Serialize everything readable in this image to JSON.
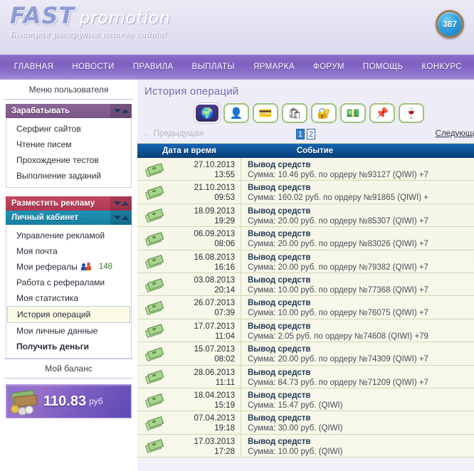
{
  "header": {
    "logo_main": "FAST",
    "logo_sub": "promotion",
    "slogan": "Быстрая раскрутка вашего сайта!",
    "counter": "387"
  },
  "nav": {
    "items": [
      {
        "label": "ГЛАВНАЯ"
      },
      {
        "label": "НОВОСТИ"
      },
      {
        "label": "ПРАВИЛА"
      },
      {
        "label": "ВЫПЛАТЫ"
      },
      {
        "label": "ЯРМАРКА"
      },
      {
        "label": "ФОРУМ"
      },
      {
        "label": "ПОМОЩЬ"
      },
      {
        "label": "КОНКУРС"
      }
    ]
  },
  "sidebar": {
    "title": "Меню пользователя",
    "earn_header": "Зарабатывать",
    "earn_items": [
      {
        "label": "Серфинг сайтов"
      },
      {
        "label": "Чтение писем"
      },
      {
        "label": "Прохождение тестов"
      },
      {
        "label": "Выполнение заданий"
      }
    ],
    "ads_header": "Разместить рекламу",
    "account_header": "Личный кабинет",
    "account_items": [
      {
        "label": "Управление рекламой"
      },
      {
        "label": "Моя почта"
      },
      {
        "label": "Мои рефералы",
        "count": "148"
      },
      {
        "label": "Работа с рефералами"
      },
      {
        "label": "Моя статистика"
      },
      {
        "label": "История операций"
      },
      {
        "label": "Мои личные данные"
      },
      {
        "label": "Получить деньги"
      }
    ],
    "balance_title": "Мой баланс",
    "balance_value": "110.83",
    "balance_currency": "руб"
  },
  "main": {
    "page_title": "История операций",
    "tabs": [
      {
        "name": "globe",
        "glyph": "🌍"
      },
      {
        "name": "person",
        "glyph": "👤"
      },
      {
        "name": "wallet",
        "glyph": "💳"
      },
      {
        "name": "shopping-bag",
        "glyph": "🛍"
      },
      {
        "name": "lock",
        "glyph": "🔐"
      },
      {
        "name": "money",
        "glyph": "💵"
      },
      {
        "name": "megaphone",
        "glyph": "📌"
      },
      {
        "name": "wine-glass",
        "glyph": "🍷"
      }
    ],
    "pager": {
      "prev": "← Предыдущая",
      "next": "Следующая",
      "pages": [
        {
          "label": "1",
          "selected": true
        },
        {
          "label": "2",
          "selected": false
        }
      ]
    },
    "table": {
      "columns": [
        "Дата и время",
        "Событие"
      ],
      "rows": [
        {
          "date": "27.10.2013",
          "time": "13:55",
          "title": "Вывод средств",
          "detail": "Сумма: 10.46 руб. по ордеру №93127 (QIWI) +7"
        },
        {
          "date": "21.10.2013",
          "time": "09:53",
          "title": "Вывод средств",
          "detail": "Сумма: 160.02 руб. по ордеру №91865 (QIWI) +"
        },
        {
          "date": "18.09.2013",
          "time": "19:29",
          "title": "Вывод средств",
          "detail": "Сумма: 20.00 руб. по ордеру №85307 (QIWI) +7"
        },
        {
          "date": "06.09.2013",
          "time": "08:06",
          "title": "Вывод средств",
          "detail": "Сумма: 20.00 руб. по ордеру №83026 (QIWI) +7"
        },
        {
          "date": "16.08.2013",
          "time": "16:16",
          "title": "Вывод средств",
          "detail": "Сумма: 20.00 руб. по ордеру №79382 (QIWI) +7"
        },
        {
          "date": "03.08.2013",
          "time": "20:14",
          "title": "Вывод средств",
          "detail": "Сумма: 10.00 руб. по ордеру №77368 (QIWI) +7"
        },
        {
          "date": "26.07.2013",
          "time": "07:39",
          "title": "Вывод средств",
          "detail": "Сумма: 10.00 руб. по ордеру №76075 (QIWI) +7"
        },
        {
          "date": "17.07.2013",
          "time": "11:04",
          "title": "Вывод средств",
          "detail": "Сумма: 2.05 руб. по ордеру №74608 (QIWI) +79"
        },
        {
          "date": "15.07.2013",
          "time": "08:02",
          "title": "Вывод средств",
          "detail": "Сумма: 20.00 руб. по ордеру №74309 (QIWI) +7"
        },
        {
          "date": "28.06.2013",
          "time": "11:11",
          "title": "Вывод средств",
          "detail": "Сумма: 84.73 руб. по ордеру №71209 (QIWI) +7"
        },
        {
          "date": "18.04.2013",
          "time": "15:19",
          "title": "Вывод средств",
          "detail": "Сумма: 15.47 руб. (QIWI)"
        },
        {
          "date": "07.04.2013",
          "time": "19:18",
          "title": "Вывод средств",
          "detail": "Сумма: 30.00 руб. (QIWI)"
        },
        {
          "date": "17.03.2013",
          "time": "17:28",
          "title": "Вывод средств",
          "detail": "Сумма: 10.00 руб. (QIWI)"
        }
      ]
    }
  }
}
